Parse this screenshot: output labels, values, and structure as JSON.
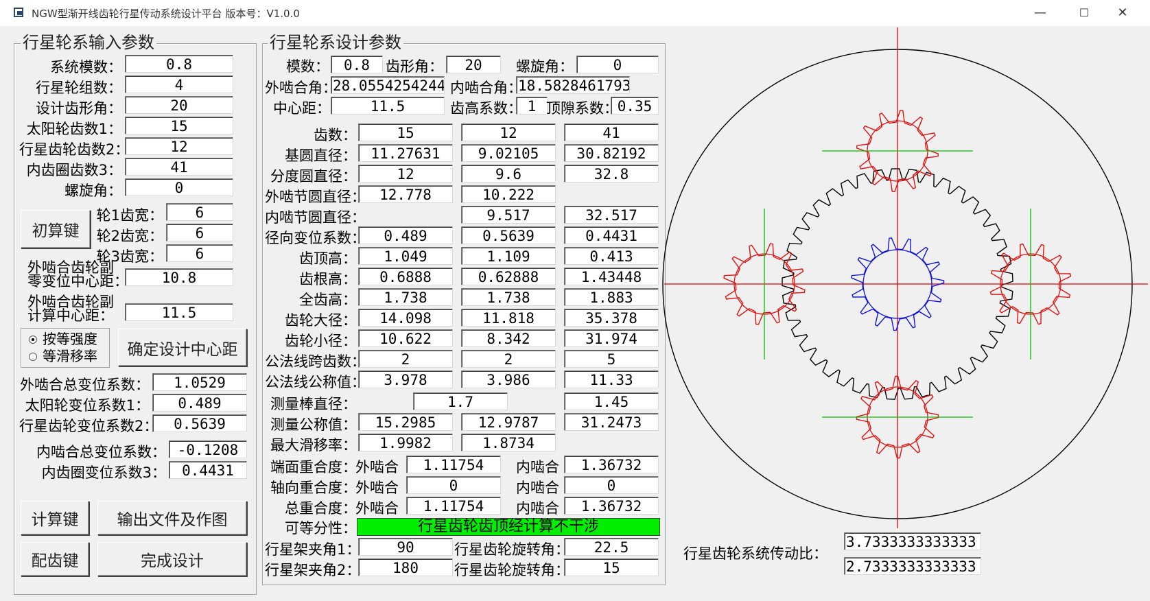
{
  "window": {
    "title": "NGW型渐开线齿轮行星传动系统设计平台  版本号：V1.0.0",
    "min": "—",
    "max": "☐",
    "close": "✕"
  },
  "left": {
    "title": "行星轮系输入参数",
    "rows": [
      {
        "label": "系统模数：",
        "value": "0.8"
      },
      {
        "label": "行星轮组数：",
        "value": "4"
      },
      {
        "label": "设计齿形角：",
        "value": "20"
      },
      {
        "label": "太阳轮齿数1：",
        "value": "15"
      },
      {
        "label": "行星齿轮齿数2：",
        "value": "12"
      },
      {
        "label": "内齿圈齿数3：",
        "value": "41"
      },
      {
        "label": "螺旋角：",
        "value": "0"
      }
    ],
    "init_btn": "初算键",
    "widths": [
      {
        "label": "轮1齿宽：",
        "value": "6"
      },
      {
        "label": "轮2齿宽：",
        "value": "6"
      },
      {
        "label": "轮3齿宽：",
        "value": "6"
      }
    ],
    "zero_center_label1": "外啮合齿轮副",
    "zero_center_label2": "零变位中心距：",
    "zero_center_value": "10.8",
    "calc_center_label1": "外啮合齿轮副",
    "calc_center_label2": "计算中心距：",
    "calc_center_value": "11.5",
    "radio1": "按等强度",
    "radio2": "等滑移率",
    "confirm_btn": "确定设计中心距",
    "ext_total_label": "外啮合总变位系数：",
    "ext_total_value": "1.0529",
    "sun_shift_label": "太阳轮变位系数1：",
    "sun_shift_value": "0.489",
    "planet_shift_label": "行星齿轮变位系数2：",
    "planet_shift_value": "0.5639",
    "int_total_label": "内啮合总变位系数：",
    "int_total_value": "-0.1208",
    "ring_shift_label": "内齿圈变位系数3：",
    "ring_shift_value": "0.4431",
    "calc_btn": "计算键",
    "output_btn": "输出文件及作图",
    "match_btn": "配齿键",
    "finish_btn": "完成设计"
  },
  "design": {
    "title": "行星轮系设计参数",
    "module_label": "模数：",
    "module_value": "0.8",
    "angle_label": "齿形角：",
    "angle_value": "20",
    "helix_label": "螺旋角：",
    "helix_value": "0",
    "ext_angle_label": "外啮合角：",
    "ext_angle_value": "28.0554254244",
    "int_angle_label": "内啮合角：",
    "int_angle_value": "18.5828461793",
    "center_label": "中心距：",
    "center_value": "11.5",
    "addendum_coef_label": "齿高系数：",
    "addendum_coef_value": "1",
    "clearance_label": "顶隙系数：",
    "clearance_value": "0.35",
    "rows": [
      {
        "label": "齿数：",
        "v": [
          "15",
          "12",
          "41"
        ]
      },
      {
        "label": "基圆直径：",
        "v": [
          "11.27631",
          "9.02105",
          "30.82192"
        ]
      },
      {
        "label": "分度圆直径：",
        "v": [
          "12",
          "9.6",
          "32.8"
        ]
      },
      {
        "label": "外啮节圆直径：",
        "v": [
          "12.778",
          "10.222",
          ""
        ]
      },
      {
        "label": "内啮节圆直径：",
        "v": [
          "",
          "9.517",
          "32.517"
        ]
      },
      {
        "label": "径向变位系数：",
        "v": [
          "0.489",
          "0.5639",
          "0.4431"
        ]
      },
      {
        "label": "齿顶高：",
        "v": [
          "1.049",
          "1.109",
          "0.413"
        ]
      },
      {
        "label": "齿根高：",
        "v": [
          "0.6888",
          "0.62888",
          "1.43448"
        ]
      },
      {
        "label": "全齿高：",
        "v": [
          "1.738",
          "1.738",
          "1.883"
        ]
      },
      {
        "label": "齿轮大径：",
        "v": [
          "14.098",
          "11.818",
          "35.378"
        ]
      },
      {
        "label": "齿轮小径：",
        "v": [
          "10.622",
          "8.342",
          "31.974"
        ]
      },
      {
        "label": "公法线跨齿数：",
        "v": [
          "2",
          "2",
          "5"
        ]
      },
      {
        "label": "公法线公称值：",
        "v": [
          "3.978",
          "3.986",
          "11.33"
        ]
      }
    ],
    "rod_label": "测量棒直径：",
    "rod_v12": "1.7",
    "rod_v3": "1.45",
    "meas_label": "测量公称值：",
    "meas_v": [
      "15.2985",
      "12.9787",
      "31.2473"
    ],
    "slip_label": "最大滑移率：",
    "slip_v": [
      "1.9982",
      "1.8734"
    ],
    "contact_rows": [
      {
        "label": "端面重合度：",
        "ext": "外啮合",
        "ext_v": "1.11754",
        "int": "内啮合",
        "int_v": "1.36732"
      },
      {
        "label": "轴向重合度：",
        "ext": "外啮合",
        "ext_v": "0",
        "int": "内啮合",
        "int_v": "0"
      },
      {
        "label": "总重合度：",
        "ext": "外啮合",
        "ext_v": "1.11754",
        "int": "内啮合",
        "int_v": "1.36732"
      }
    ],
    "equal_label": "可等分性：",
    "equal_status": "行星齿轮齿顶经计算不干涉",
    "carrier1_label": "行星架夹角1：",
    "carrier1_value": "90",
    "carrier2_label": "行星架夹角2：",
    "carrier2_value": "180",
    "rot1_label": "行星齿轮旋转角：",
    "rot1_value": "22.5",
    "rot2_label": "行星齿轮旋转角：",
    "rot2_value": "15"
  },
  "ratio": {
    "label": "行星齿轮系统传动比：",
    "v1": "3.7333333333333",
    "v2": "2.7333333333333"
  },
  "colors": {
    "sun": "#1010e0",
    "planet": "#e01010",
    "ring": "#000000",
    "axis_red": "#e00000",
    "axis_green": "#00c000",
    "status": "#00ee00"
  }
}
